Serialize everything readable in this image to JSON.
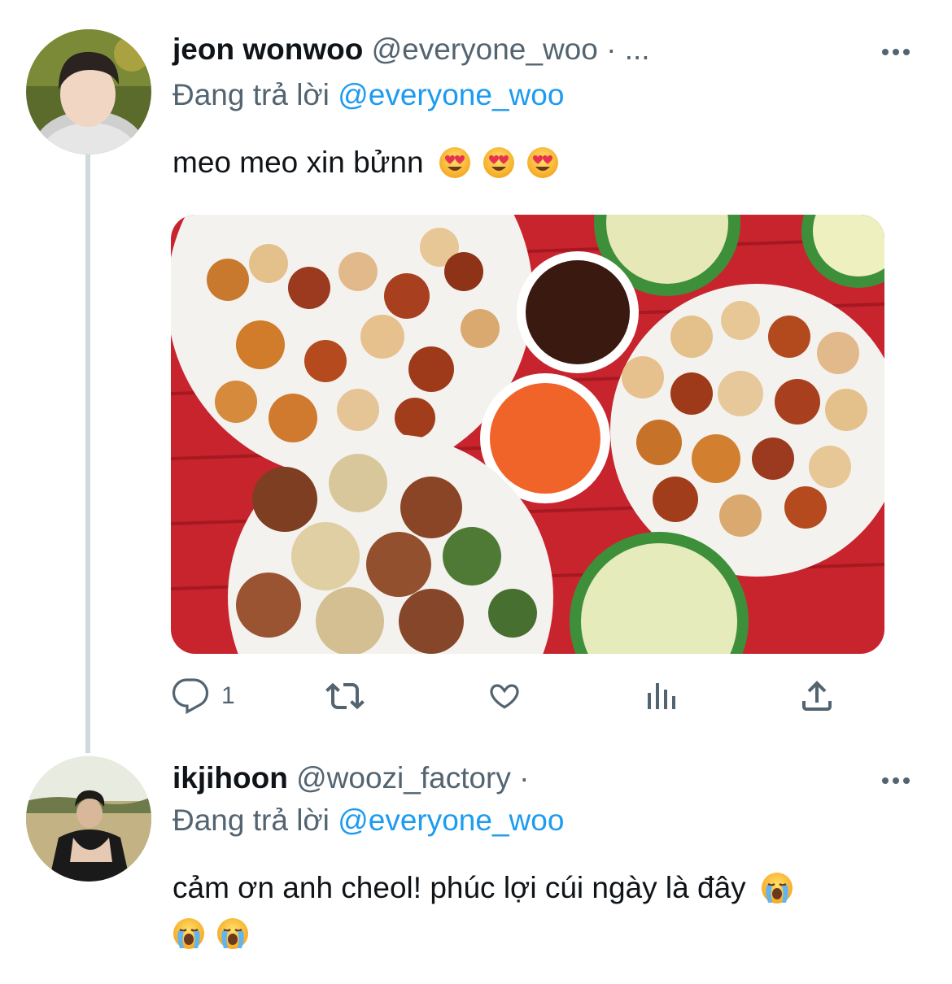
{
  "tweets": [
    {
      "name": "jeon wonwoo",
      "handle": "@everyone_woo",
      "separator": "·",
      "time": "...",
      "replying_prefix": "Đang trả lời",
      "replying_to": "@everyone_woo",
      "text": "meo meo xin bửnn",
      "emojis": [
        "heart-eyes",
        "heart-eyes",
        "heart-eyes"
      ],
      "reply_count": "1"
    },
    {
      "name": "ikjihoon",
      "handle": "@woozi_factory",
      "separator": "·",
      "replying_prefix": "Đang trả lời",
      "replying_to": "@everyone_woo",
      "text_line1": "cảm ơn anh cheol! phúc lợi cúi ngày là đây",
      "emojis": [
        "loudly-crying",
        "loudly-crying",
        "loudly-crying"
      ]
    }
  ],
  "icons": [
    "reply-icon",
    "retweet-icon",
    "like-icon",
    "analytics-icon",
    "share-icon",
    "more-icon"
  ],
  "colors": {
    "link": "#1d9bf0",
    "secondary": "#536471",
    "thread": "#cfd9de",
    "table": "#c8242e"
  }
}
